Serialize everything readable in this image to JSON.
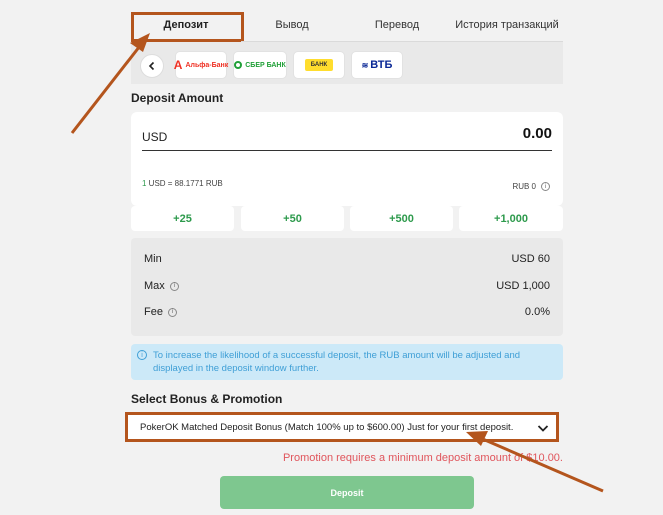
{
  "tabs": [
    {
      "label": "Депозит"
    },
    {
      "label": "Вывод"
    },
    {
      "label": "Перевод"
    },
    {
      "label": "История транзакций"
    }
  ],
  "banks": [
    {
      "name": "Альфа-Банк",
      "icon": "alfa-bank-logo"
    },
    {
      "name": "СБЕР БАНК",
      "icon": "sber-bank-logo"
    },
    {
      "name": "БАНК",
      "icon": "t-bank-logo"
    },
    {
      "name": "ВТБ",
      "icon": "vtb-logo"
    }
  ],
  "deposit": {
    "title": "Deposit Amount",
    "currency": "USD",
    "amount": "0.00",
    "rate_prefix": "1",
    "rate_rest": " USD = 88.1771 RUB",
    "rub_amount": "RUB 0"
  },
  "quick_amounts": [
    "+25",
    "+50",
    "+500",
    "+1,000"
  ],
  "limits": {
    "min_label": "Min",
    "min_value": "USD 60",
    "max_label": "Max",
    "max_value": "USD 1,000",
    "fee_label": "Fee",
    "fee_value": "0.0%"
  },
  "notice": "To increase the likelihood of a successful deposit, the RUB amount will be adjusted and displayed in the deposit window further.",
  "bonus": {
    "title": "Select Bonus & Promotion",
    "selected": "PokerOK Matched Deposit Bonus (Match 100% up to $600.00) Just for your first deposit.",
    "warning": "Promotion requires a minimum deposit amount of $10.00."
  },
  "deposit_button": "Deposit",
  "colors": {
    "accent_green": "#2d9a4c",
    "button_green": "#7ec78f",
    "annotation_orange": "#b4551d",
    "warning_red": "#e0555c",
    "info_blue": "#3f9fd6"
  }
}
